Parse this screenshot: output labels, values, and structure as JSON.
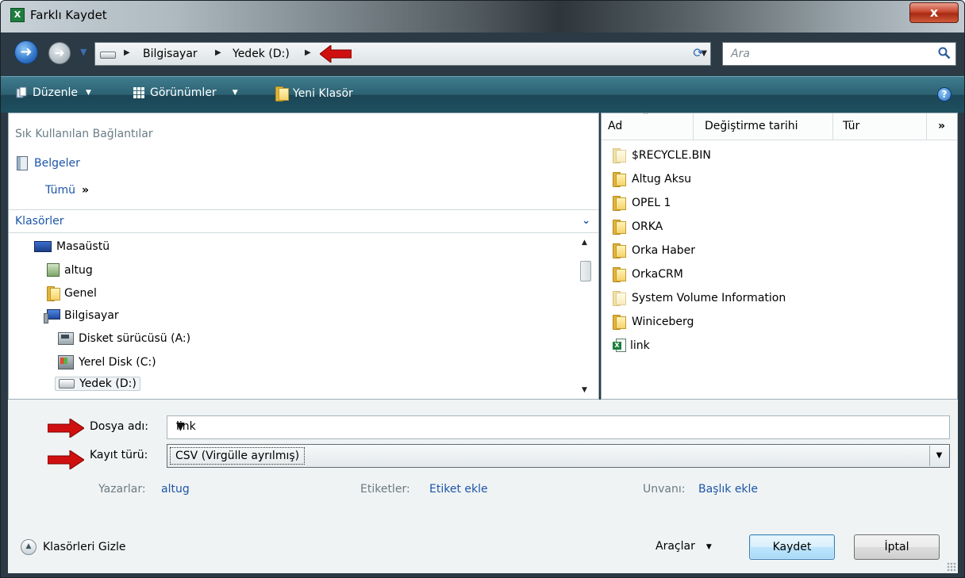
{
  "window": {
    "title": "Farklı Kaydet",
    "app_icon": "X",
    "close_glyph": "x"
  },
  "address": {
    "crumbs": [
      "Bilgisayar",
      "Yedek (D:)"
    ],
    "search_placeholder": "Ara"
  },
  "toolbar": {
    "organize": "Düzenle",
    "views": "Görünümler",
    "new_folder": "Yeni Klasör",
    "help": "?"
  },
  "nav": {
    "favorites_title": "Sık Kullanılan Bağlantılar",
    "documents": "Belgeler",
    "all": "Tümü",
    "all_more": "»",
    "folders_title": "Klasörler",
    "tree": [
      "Masaüstü",
      "altug",
      "Genel",
      "Bilgisayar",
      "Disket sürücüsü (A:)",
      "Yerel Disk (C:)",
      "Yedek (D:)"
    ]
  },
  "files": {
    "columns": [
      "Ad",
      "Değiştirme tarihi",
      "Tür",
      "»"
    ],
    "items": [
      "$RECYCLE.BIN",
      "Altug Aksu",
      "OPEL 1",
      "ORKA",
      "Orka Haber",
      "OrkaCRM",
      "System Volume Information",
      "Winiceberg",
      "link"
    ]
  },
  "form": {
    "file_name_label": "Dosya adı:",
    "file_name_value": "link",
    "file_type_label": "Kayıt türü:",
    "file_type_value": "CSV (Virgülle ayrılmış)",
    "authors_label": "Yazarlar:",
    "authors_value": "altug",
    "tags_label": "Etiketler:",
    "tags_value": "Etiket ekle",
    "title_label": "Unvanı:",
    "title_value": "Başlık ekle"
  },
  "footer": {
    "hide_folders": "Klasörleri Gizle",
    "tools": "Araçlar",
    "save": "Kaydet",
    "cancel": "İptal"
  },
  "colors": {
    "accent_link": "#1c55a8",
    "annotation_arrow": "#d01010",
    "toolbar": "#2c6172"
  }
}
